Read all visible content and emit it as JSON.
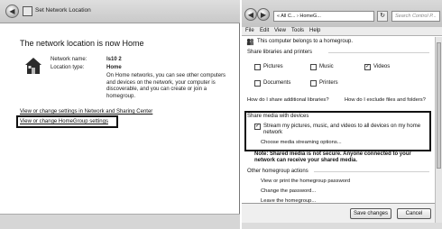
{
  "left_window": {
    "title": "Set Network Location",
    "heading": "The network location is now Home",
    "network_name_label": "Network name:",
    "network_name_value": "ls10  2",
    "location_type_label": "Location type:",
    "location_type_value": "Home",
    "description": "On Home networks, you can see other computers and devices on the network, your computer is discoverable, and you can create or join a homegroup.",
    "link_network_center": "View or change settings in Network and Sharing Center",
    "link_homegroup": "View or change HomeGroup settings"
  },
  "right_window": {
    "address": "« All C... › HomeG...",
    "search_placeholder": "Search Control P...",
    "menu": [
      "File",
      "Edit",
      "View",
      "Tools",
      "Help"
    ],
    "belongs_text": "This computer belongs to a homegroup.",
    "share_libraries_heading": "Share libraries and printers",
    "libraries": [
      {
        "label": "Pictures",
        "checked": false
      },
      {
        "label": "Music",
        "checked": false
      },
      {
        "label": "Videos",
        "checked": true
      },
      {
        "label": "Documents",
        "checked": false
      },
      {
        "label": "Printers",
        "checked": false
      }
    ],
    "link_share_additional": "How do I share additional libraries?",
    "link_exclude": "How do I exclude files and folders?",
    "share_media_heading": "Share media with devices",
    "stream_label": "Stream my pictures, music, and videos to all devices on my home network",
    "stream_checked": true,
    "choose_streaming": "Choose media streaming options...",
    "note": "Note: Shared media is not secure. Anyone connected to your network can receive your shared media.",
    "other_actions_heading": "Other homegroup actions",
    "actions": [
      "View or print the homegroup password",
      "Change the password...",
      "Leave the homegroup..."
    ],
    "save_label": "Save changes",
    "cancel_label": "Cancel"
  },
  "icons": {
    "check": "✓",
    "refresh": "↻",
    "search": "⚲"
  }
}
